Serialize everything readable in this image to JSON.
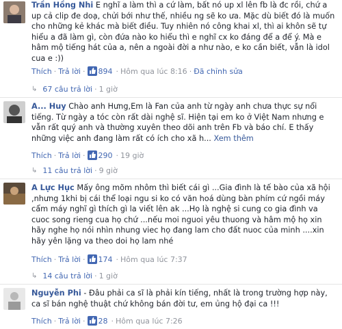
{
  "comments": [
    {
      "author": "Trần Hồng Nhi",
      "text": "E nghĩ a làm thì a cứ làm, bất nó up xl lên fb là đc rồi, chứ a up cả clip đe doạ, chửi bới như thế, nhiều ng sẽ ko ưa. Mặc dù biết đó là muốn cho những kẻ khác mà biết điều. Tuy nhiên nó công khai xl, thì ai khôn sẽ tự hiểu a đã làm gì, còn đứa nào ko hiểu thì e nghĩ cx ko đáng để a để ý. Mà e hâm mộ tiếng hát của a, nên a ngoài đời a như nào, e ko cần biết, vẫn là idol cua e :))",
      "like_label": "Thích",
      "reply_label": "Trả lời",
      "likes": "894",
      "time": "Hôm qua lúc 8:16",
      "extra": "Đã chỉnh sửa",
      "replies_label": "67 câu trả lời",
      "replies_time": "1 giờ",
      "see_more": ""
    },
    {
      "author": "A... Huy",
      "text": "Chào anh Hưng,Em là Fan của anh từ ngày anh chưa thực sự nổi tiếng. Từ ngày a tóc còn rất dài nghệ sĩ. Hiện tại em ko ở Việt Nam nhưng e vẫn rất quý anh và thường xuyên theo dõi anh trên Fb và báo chí. E thấy những việc anh đang làm rất có ích cho xã h...",
      "see_more": "Xem thêm",
      "like_label": "Thích",
      "reply_label": "Trả lời",
      "likes": "290",
      "time": "19 giờ",
      "replies_label": "11 câu trả lời",
      "replies_time": "9 giờ"
    },
    {
      "author": "A Lực Hục",
      "text": "Mấy ông mõm nhôm thì biết cái gì ...Gia đình là tế bào của xã hội ,nhưng 1khi bị cái thể loại ngu si ko có văn hoá dùng bàn phím cứ ngồi máy cẩm máy nghĩ gì thích gì la viết lên ak ...Họ là nghệ si cung co gia đình va cuoc song rieng cua họ chứ ...nếu moi nguoi yêu thuong và hâm mộ họ xin hãy nghe họ nói nhìn nhung viec họ đang lam cho đất nuoc của minh ....xin hãy yên lặng va theo doi họ lam nhé",
      "like_label": "Thích",
      "reply_label": "Trả lời",
      "likes": "174",
      "time": "Hôm qua lúc 7:37",
      "replies_label": "14 câu trả lời",
      "replies_time": "1 giờ",
      "see_more": ""
    },
    {
      "author": "Nguyễn Phi",
      "text": " - Đâu phải ca sĩ là phải kín tiếng, nhất là trong trường hợp này, ca sĩ bán nghệ thuật chứ không bán đời tư, em ủng hộ đại ca !!!",
      "like_label": "Thích",
      "reply_label": "Trả lời",
      "likes": "28",
      "time": "Hôm qua lúc 7:26",
      "see_more": ""
    }
  ],
  "colors": {
    "link": "#365899",
    "meta": "#90949c",
    "like_blue": "#4267b2"
  },
  "icons": {
    "like": "thumbs-up-icon",
    "reply_arrow": "reply-arrow-icon"
  }
}
